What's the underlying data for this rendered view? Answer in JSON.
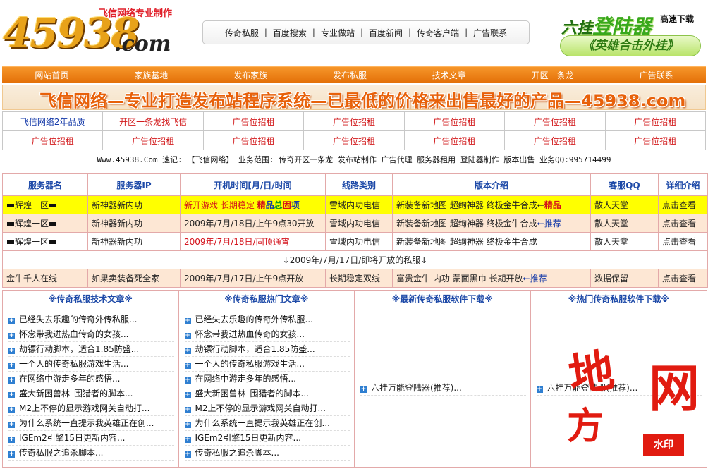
{
  "header": {
    "logo_number": "45938",
    "logo_domain": ".com",
    "logo_tagline": "飞信网络专业制作",
    "top_nav": [
      "传奇私服",
      "百度搜索",
      "专业做站",
      "百度新闻",
      "传奇客户端",
      "广告联系"
    ],
    "promo": {
      "prefix": "六挂",
      "title": "登陆器",
      "download": "高速下载",
      "subtitle": "《英雄合击外挂》"
    }
  },
  "main_nav": [
    "网站首页",
    "家族基地",
    "发布家族",
    "发布私服",
    "技术文章",
    "开区一条龙",
    "广告联系"
  ],
  "banner": {
    "text": "飞信网络—专业打造发布站程序系统—已最低的价格来出售最好的产品—45938.com"
  },
  "ad_grid": {
    "row1": [
      "飞信网络2年品质",
      "开区一条龙找飞信",
      "广告位招租",
      "广告位招租",
      "广告位招租",
      "广告位招租",
      "广告位招租"
    ],
    "row2": [
      "广告位招租",
      "广告位招租",
      "广告位招租",
      "广告位招租",
      "广告位招租",
      "广告位招租",
      "广告位招租"
    ]
  },
  "info_line": "Www.45938.Com 速记: 【飞信网络】 业务范围: 传奇开区一条龙 发布站制作 广告代理 服务器租用 登陆器制作 版本出售 业务QQ:995714499",
  "server_table": {
    "headers": [
      "服务器名",
      "服务器IP",
      "开机时间[月/日/时间",
      "线路类别",
      "版本介绍",
      "客服QQ",
      "详细介绍"
    ],
    "rows": [
      {
        "name": "辉煌一区",
        "ip": "新神器新内功",
        "time_a": "新开游戏 长期稳定 ",
        "time_b": "精",
        "time_c": "品",
        "time_d": "总",
        "time_e": "固",
        "time_f": "项",
        "line": "雪域内功电信",
        "version": "新装备新地图 超绚神器 终极金牛合成←",
        "version_tag": "精品",
        "qq": "散人天堂",
        "detail": "点击查看"
      },
      {
        "name": "辉煌一区",
        "ip": "新神器新内功",
        "time": "2009年/7月/18日/上午9点30开放",
        "line": "雪域内功电信",
        "version": "新装备新地图 超绚神器 终极金牛合成",
        "version_tag": "←推荐",
        "qq": "散人天堂",
        "detail": "点击查看"
      },
      {
        "name": "辉煌一区",
        "ip": "新神器新内功",
        "time": "2009年/7月/18日/固顶通宵",
        "line": "雪域内功电信",
        "version": "新装备新地图 超绚神器 终极金牛合成",
        "qq": "散人天堂",
        "detail": "点击查看"
      }
    ],
    "divider": "↓2009年/7月/17日/即将开放的私服↓",
    "upcoming": {
      "name": "金牛千人在线",
      "ip": "如果卖装备死全家",
      "time": "2009年/7月/17日/上午9点开放",
      "line": "长期稳定双线",
      "version": "富贵金牛 内功 蒙面黑巾 长期开放",
      "version_tag": "←推荐",
      "qq": "数据保留",
      "detail": "点击查看"
    }
  },
  "lists": [
    {
      "title": "※传奇私服技术文章※",
      "items": [
        "已经失去乐趣的传奇外传私服...",
        "怀念带我进热血传奇的女孩...",
        "劫镖行动脚本，适合1.85防盛...",
        "一个人的传奇私服游戏生活...",
        "在网络中游走多年的感悟...",
        "盛大新困兽林_围猎者的脚本...",
        "M2上不停的显示游戏网关自动打...",
        "为什么系统一直提示我英雄正在创...",
        "IGEm2引擎15日更新内容...",
        "传奇私服之追杀脚本..."
      ]
    },
    {
      "title": "※传奇私服热门文章※",
      "items": [
        "已经失去乐趣的传奇外传私服...",
        "怀念带我进热血传奇的女孩...",
        "劫镖行动脚本，适合1.85防盛...",
        "一个人的传奇私服游戏生活...",
        "在网络中游走多年的感悟...",
        "盛大新困兽林_围猎者的脚本...",
        "M2上不停的显示游戏网关自动打...",
        "为什么系统一直提示我英雄正在创...",
        "IGEm2引擎15日更新内容...",
        "传奇私服之追杀脚本..."
      ]
    },
    {
      "title": "※最新传奇私服软件下载※",
      "items": [
        "六挂万能登陆器(推荐)..."
      ]
    },
    {
      "title": "※热门传奇私服软件下载※",
      "items": [
        "六挂万能登陆器(推荐)..."
      ]
    }
  ],
  "watermark": {
    "char1": "地",
    "char2": "网",
    "char3": "方",
    "stamp": "水印"
  }
}
